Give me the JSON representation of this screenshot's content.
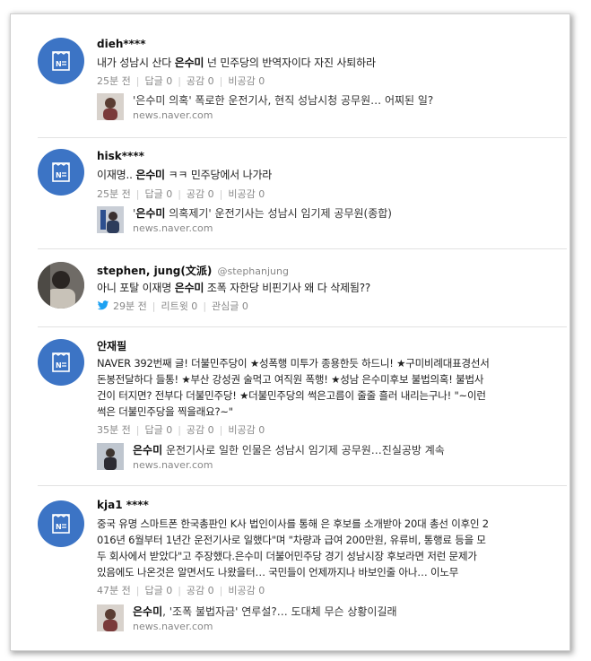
{
  "comments": [
    {
      "author": "dieh****",
      "text_before": "내가 성남시 산다 ",
      "text_highlight": "은수미",
      "text_after": " 넌 민주당의 반역자이다 자진 사퇴하라",
      "time": "25분 전",
      "reply": "답글 0",
      "like": "공감 0",
      "dislike": "비공감 0",
      "link_title": "'은수미 의혹' 폭로한 운전기사, 현직 성남시청 공무원… 어찌된 일?",
      "link_url": "news.naver.com"
    },
    {
      "author": "hisk****",
      "text_before": "이재명.. ",
      "text_highlight": "은수미",
      "text_after": " ㅋㅋ 민주당에서 나가라",
      "time": "25분 전",
      "reply": "답글 0",
      "like": "공감 0",
      "dislike": "비공감 0",
      "link_title_before": "'",
      "link_title_highlight": "은수미",
      "link_title_after": " 의혹제기' 운전기사는 성남시 임기제 공무원(종합)",
      "link_url": "news.naver.com"
    },
    {
      "author": "stephen, jung(文派)",
      "handle": "@stephanjung",
      "text_before": "아니 포탈 이재명 ",
      "text_highlight": "은수미",
      "text_after": " 조폭 자한당 비핀기사 왜 다 삭제됨??",
      "time": "29분 전",
      "retweet": "리트윗 0",
      "interest": "관심글 0"
    },
    {
      "author": "안재필",
      "line1": "NAVER 392번째 글! 더불민주당이 ★성폭행 미투가 종용한듯 하드니! ★구미비례대표경선서",
      "line2": "돈봉전달하다 들통! ★부산 강성권 술먹고 여직원 폭행! ★성남 은수미후보 불법의혹! 불법사",
      "line3": "건이 터지면? 전부다 더불민주당! ★더불민주당의 썩은고름이 줄줄 흘러 내리는구나! \"~이런",
      "line4": "썩은 더불민주당을 찍을래요?~\"",
      "time": "35분 전",
      "reply": "답글 0",
      "like": "공감 0",
      "dislike": "비공감 0",
      "link_title_highlight": "은수미",
      "link_title_after": " 운전기사로 일한 인물은 성남시 임기제 공무원…진실공방 계속",
      "link_url": "news.naver.com"
    },
    {
      "author": "kja1 ****",
      "line1": "중국 유명 스마트폰 한국총판인 K사 법인이사를 통해 은 후보를 소개받아 20대 총선 이후인 2",
      "line2": "016년 6월부터 1년간 운전기사로 일했다\"며 \"차량과 급여 200만원, 유류비, 통행료 등을 모",
      "line3": "두 회사에서 받았다\"고 주장했다.은수미 더불어민주당 경기 성남시장 후보라면 저런 문제가",
      "line4": "있음에도 나온것은 알면서도 나왔을터… 국민들이 언제까지나 바보인줄 아나… 이노무",
      "time": "47분 전",
      "reply": "답글 0",
      "like": "공감 0",
      "dislike": "비공감 0",
      "link_title_highlight": "은수미",
      "link_title_after": ", '조폭 불법자금' 연루설?… 도대체 무슨 상황이길래",
      "link_url": "news.naver.com"
    }
  ],
  "colors": {
    "naver_badge": "#3c74c5",
    "twitter": "#1da1f2"
  },
  "icons": {
    "naver": "naver-news-icon",
    "twitter": "twitter-bird-icon"
  }
}
